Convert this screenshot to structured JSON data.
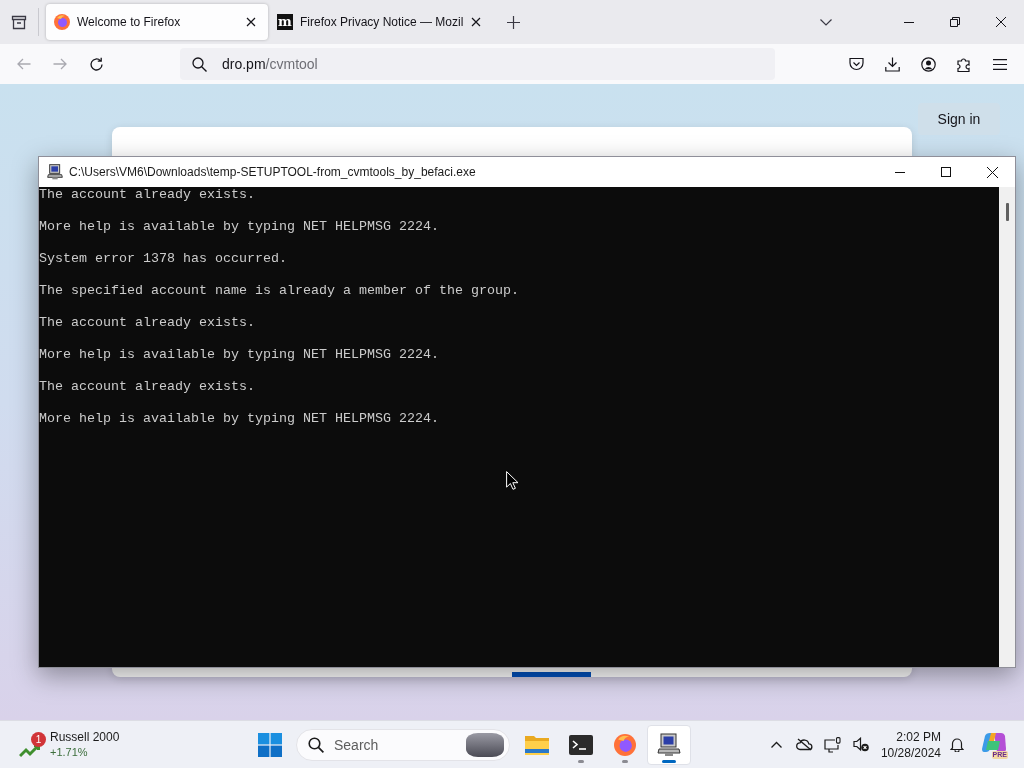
{
  "browser": {
    "tabs": [
      {
        "kind": "firefox",
        "title": "Welcome to Firefox",
        "selected": true
      },
      {
        "kind": "letter",
        "favicon": "m",
        "title": "Firefox Privacy Notice — Mozil",
        "selected": false
      }
    ],
    "nav": [
      {
        "kind": "back",
        "disabled": true
      },
      {
        "kind": "forward",
        "disabled": true
      },
      {
        "kind": "reload",
        "disabled": false
      }
    ],
    "address": {
      "host": "dro.pm",
      "path": "/cvmtool"
    },
    "page": {
      "sign_in": "Sign in"
    }
  },
  "console": {
    "title": "C:\\Users\\VM6\\Downloads\\temp-SETUPTOOL-from_cvmtools_by_befaci.exe",
    "lines": [
      "The account already exists.",
      "More help is available by typing NET HELPMSG 2224.",
      "System error 1378 has occurred.",
      "The specified account name is already a member of the group.",
      "The account already exists.",
      "More help is available by typing NET HELPMSG 2224.",
      "The account already exists.",
      "More help is available by typing NET HELPMSG 2224."
    ]
  },
  "taskbar": {
    "widget": {
      "badge": "1",
      "name": "Russell 2000",
      "change": "+1.71%"
    },
    "search": {
      "placeholder": "Search"
    },
    "apps": [
      {
        "kind": "folder",
        "running": false,
        "selected": false
      },
      {
        "kind": "terminal",
        "running": true,
        "selected": false
      },
      {
        "kind": "firefox",
        "running": true,
        "selected": false
      },
      {
        "kind": "computer",
        "running": true,
        "selected": true
      }
    ],
    "clock": {
      "time": "2:02 PM",
      "date": "10/28/2024"
    },
    "copilot": {
      "badge": "PRE"
    }
  }
}
